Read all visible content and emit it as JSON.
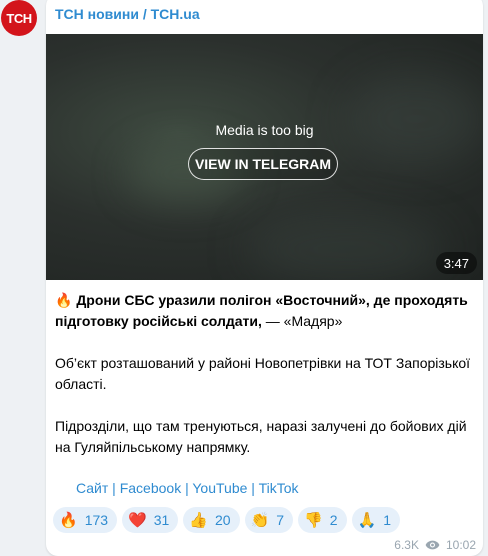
{
  "channel": {
    "avatar_text": "ТСН",
    "name": "ТСН новини / ТСН.ua"
  },
  "media": {
    "message": "Media is too big",
    "button": "VIEW IN TELEGRAM",
    "duration": "3:47"
  },
  "post": {
    "headline_emoji": "🔥",
    "headline_bold": "Дрони СБС уразили полігон «Восточний», де проходять підготовку російські солдати,",
    "headline_tail": " — «Мадяр»",
    "paragraph1": "Об’єкт розташований у районі Новопетрівки на ТОТ Запорізької області.",
    "paragraph2": "Підрозділи, що там тренуються, наразі залучені до бойових дій на Гуляйпільському напрямку."
  },
  "links": [
    {
      "label": "Сайт"
    },
    {
      "label": "Facebook"
    },
    {
      "label": "YouTube"
    },
    {
      "label": "TikTok"
    }
  ],
  "link_separator": " | ",
  "reactions": [
    {
      "emoji": "🔥",
      "count": "173"
    },
    {
      "emoji": "❤️",
      "count": "31"
    },
    {
      "emoji": "👍",
      "count": "20"
    },
    {
      "emoji": "👏",
      "count": "7"
    },
    {
      "emoji": "👎",
      "count": "2"
    },
    {
      "emoji": "🙏",
      "count": "1"
    }
  ],
  "meta": {
    "views": "6.3K",
    "time": "10:02"
  },
  "colors": {
    "accent": "#2f8bd0",
    "avatar_bg": "#d3141b",
    "reaction_bg": "#e6f0fa"
  }
}
